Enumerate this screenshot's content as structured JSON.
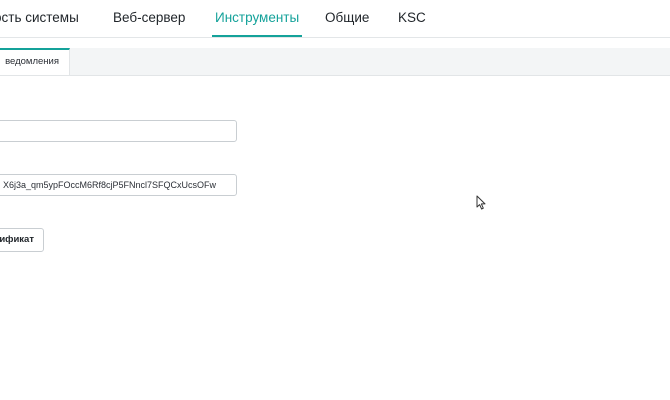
{
  "top_nav": {
    "tabs": [
      {
        "label": "ость системы"
      },
      {
        "label": "Веб-сервер"
      },
      {
        "label": "Инструменты",
        "active": true
      },
      {
        "label": "Общие"
      },
      {
        "label": "KSC"
      }
    ]
  },
  "sub_tabs": {
    "active_label": "ведомления"
  },
  "form": {
    "field1_value": "",
    "field2_value": "X6j3a_qm5ypFOccM6Rf8cjP5FNncl7SFQCxUcsOFw",
    "certificate_button_label": "ификат"
  },
  "colors": {
    "accent": "#14a29a",
    "border": "#c9ced2",
    "subbar_bg": "#f3f5f6"
  }
}
